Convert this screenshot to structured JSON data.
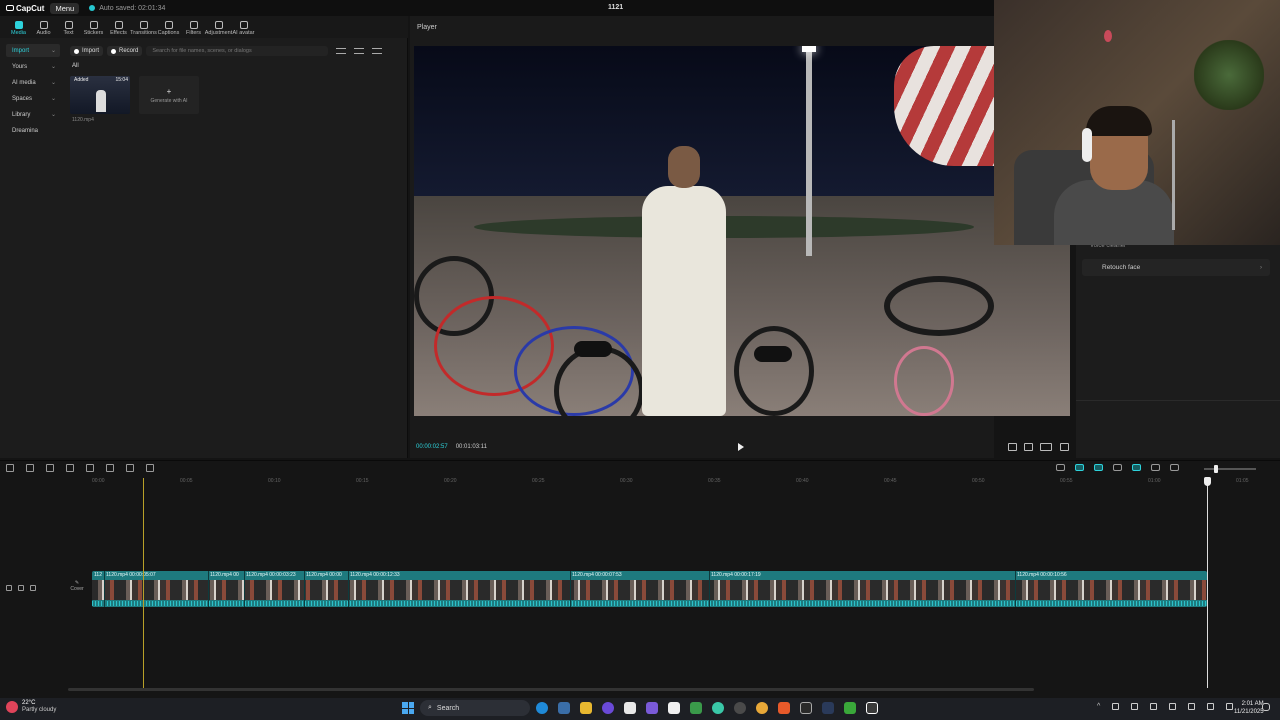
{
  "app": {
    "logo_text": "CapCut",
    "menu_label": "Menu",
    "autosave_text": "Auto saved: 02:01:34",
    "project_title": "1121"
  },
  "toolbar": {
    "items": [
      {
        "label": "Media",
        "icon": "media-icon"
      },
      {
        "label": "Audio",
        "icon": "audio-icon"
      },
      {
        "label": "Text",
        "icon": "text-icon"
      },
      {
        "label": "Stickers",
        "icon": "stickers-icon"
      },
      {
        "label": "Effects",
        "icon": "effects-icon"
      },
      {
        "label": "Transitions",
        "icon": "transitions-icon"
      },
      {
        "label": "Captions",
        "icon": "captions-icon"
      },
      {
        "label": "Filters",
        "icon": "filters-icon"
      },
      {
        "label": "Adjustment",
        "icon": "adjustment-icon"
      },
      {
        "label": "AI avatar",
        "icon": "ai-avatar-icon"
      }
    ]
  },
  "sidenav": {
    "items": [
      {
        "label": "Import"
      },
      {
        "label": "Yours"
      },
      {
        "label": "AI media"
      },
      {
        "label": "Spaces"
      },
      {
        "label": "Library"
      },
      {
        "label": "Dreamina"
      }
    ]
  },
  "media": {
    "import_label": "Import",
    "record_label": "Record",
    "search_placeholder": "Search for file names, scenes, or dialogs",
    "filter_tab": "All",
    "clip": {
      "status": "Added",
      "duration": "15:04",
      "name": "1120.mp4"
    },
    "generate_label": "Generate with AI"
  },
  "player": {
    "label": "Player",
    "current_time": "00:00:02:57",
    "total_time": "00:01:03:11"
  },
  "right_panel": {
    "previous_item": "Voice cleaner",
    "retouch_label": "Retouch face"
  },
  "timeline": {
    "ruler_ticks": [
      "00:00",
      "00:05",
      "00:10",
      "00:15",
      "00:20",
      "00:25",
      "00:30",
      "00:35",
      "00:40",
      "00:45",
      "00:50",
      "00:55",
      "01:00",
      "01:05"
    ],
    "cover_label": "Cover",
    "clips": [
      {
        "label": "112"
      },
      {
        "label": "1120.mp4  00:00:05:07"
      },
      {
        "label": "1120.mp4  00"
      },
      {
        "label": "1120.mp4  00:00:03:23"
      },
      {
        "label": "1120.mp4  00:00"
      },
      {
        "label": "1120.mp4  00:00:12:33"
      },
      {
        "label": "1120.mp4  00:00:07:53"
      },
      {
        "label": "1120.mp4  00:00:17:19"
      },
      {
        "label": "1120.mp4  00:00:10:56"
      }
    ]
  },
  "taskbar": {
    "temperature": "22°C",
    "weather": "Partly cloudy",
    "search_label": "Search",
    "time": "2:01 AM",
    "date": "11/21/2025"
  },
  "colors": {
    "accent": "#2ed3dc",
    "track": "#1e7a7e",
    "playhead": "#b8a028"
  }
}
